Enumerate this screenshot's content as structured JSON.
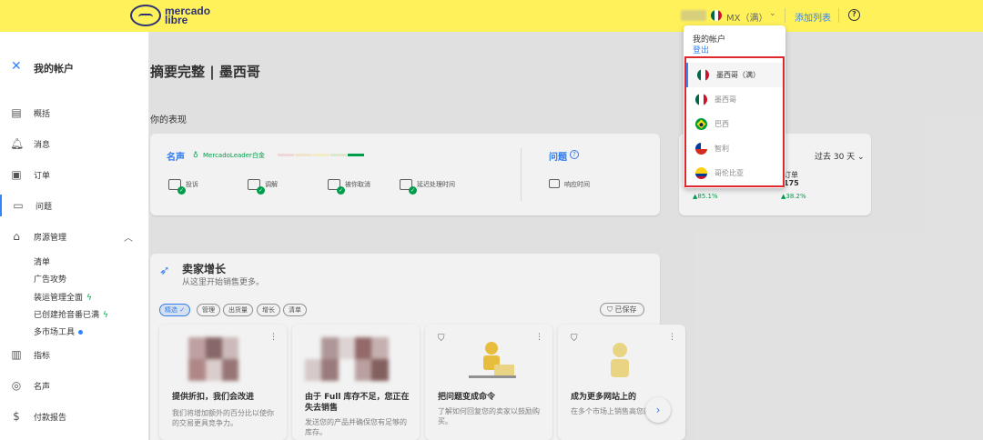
{
  "topbar": {
    "logo_line1": "mercado",
    "logo_line2": "libre",
    "site": "MX（满）",
    "add_listing": "添加列表",
    "help": "?"
  },
  "sidebar": {
    "title": "我的帐户",
    "items": [
      {
        "label": "概括",
        "icon": "summary-icon"
      },
      {
        "label": "消息",
        "icon": "bell-icon"
      },
      {
        "label": "订单",
        "icon": "orders-icon"
      },
      {
        "label": "问题",
        "icon": "chat-icon"
      },
      {
        "label": "房源管理",
        "icon": "store-icon"
      }
    ],
    "subitems": [
      {
        "label": "清单"
      },
      {
        "label": "广告攻势"
      },
      {
        "label": "装运管理全面"
      },
      {
        "label": "已创建抢音番已满"
      },
      {
        "label": "多市场工具"
      }
    ],
    "items2": [
      {
        "label": "指标",
        "icon": "bars-icon"
      },
      {
        "label": "名声",
        "icon": "medal-icon"
      },
      {
        "label": "付款报告",
        "icon": "dollar-icon"
      }
    ]
  },
  "main": {
    "page_title": "摘要完整 | 墨西哥",
    "perf_label": "你的表现",
    "reputation": {
      "title": "名声",
      "leader": "MercadoLeader白金",
      "metrics": [
        "投诉",
        "调解",
        "被你取消",
        "延迟处理时间"
      ]
    },
    "questions": {
      "title": "问题",
      "metric": "响应时间"
    },
    "sales_card": {
      "period": "过去 30 天",
      "label": "订单",
      "value": "175",
      "up1": "▲85.1%",
      "up2": "▲38.2%"
    },
    "growth": {
      "title": "卖家增长",
      "subtitle": "从这里开始销售更多。",
      "chips": [
        "精选",
        "管理",
        "出货量",
        "增长",
        "清单"
      ],
      "saved": "已保存",
      "tiles": [
        {
          "title": "提供折扣，我们会改进",
          "body": "我们将增加额外的百分比以使你的交易更具竞争力。"
        },
        {
          "title": "由于 Full 库存不足，您正在失去销售",
          "body": "发送您的产品并确保您有足够的库存。"
        },
        {
          "title": "把问题变成命令",
          "body": "了解如何回复您的卖家以鼓励购买。"
        },
        {
          "title": "成为更多网站上的",
          "body": "在多个市场上销售高您的影响"
        }
      ]
    }
  },
  "dropdown": {
    "heading": "我的帐户",
    "logout": "登出",
    "sites": [
      {
        "label": "墨西哥（满）",
        "flag": "mexico-flag",
        "selected": true
      },
      {
        "label": "墨西哥",
        "flag": "mexico-flag",
        "selected": false
      },
      {
        "label": "巴西",
        "flag": "brazil-flag",
        "selected": false
      },
      {
        "label": "智利",
        "flag": "chile-flag",
        "selected": false
      },
      {
        "label": "哥伦比亚",
        "flag": "colombia-flag",
        "selected": false
      }
    ]
  },
  "colors": {
    "brand_yellow": "#fff159",
    "accent_blue": "#3483fa",
    "success_green": "#00a650",
    "highlight_red": "#e0272c"
  }
}
